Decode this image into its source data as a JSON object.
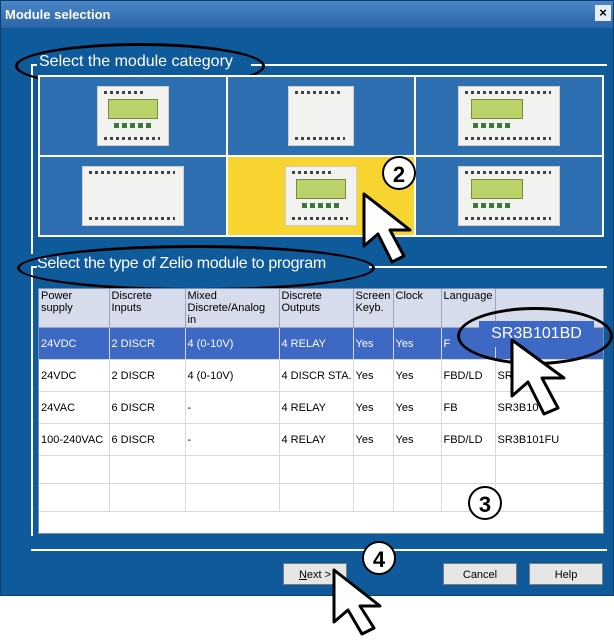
{
  "window": {
    "title": "Module selection",
    "close_label": "×"
  },
  "category_section": {
    "caption": "Select the module category"
  },
  "type_section": {
    "caption": "Select the type of Zelio module to program"
  },
  "table": {
    "headers": [
      "Power supply",
      "Discrete Inputs",
      "Mixed Discrete/Analog in",
      "Discrete Outputs",
      "Screen Keyb.",
      "Clock",
      "Language",
      ""
    ],
    "rows": [
      [
        "24VDC",
        "2 DISCR",
        "4 (0-10V)",
        "4 RELAY",
        "Yes",
        "Yes",
        "F",
        "SR3B101BD"
      ],
      [
        "24VDC",
        "2 DISCR",
        "4 (0-10V)",
        "4 DISCR STA.",
        "Yes",
        "Yes",
        "FBD/LD",
        "SR"
      ],
      [
        "24VAC",
        "6 DISCR",
        "-",
        "4 RELAY",
        "Yes",
        "Yes",
        "FB",
        "SR3B10"
      ],
      [
        "100-240VAC",
        "6 DISCR",
        "-",
        "4 RELAY",
        "Yes",
        "Yes",
        "FBD/LD",
        "SR3B101FU"
      ]
    ],
    "selected_reference": "SR3B101BD"
  },
  "buttons": {
    "next_prefix": "N",
    "next_rest": "ext >",
    "cancel": "Cancel",
    "help": "Help"
  },
  "callouts": {
    "step2": "2",
    "step3": "3",
    "step4": "4"
  },
  "colors": {
    "window_bg": "#0f5a9a",
    "tile_bg": "#2e6fb1",
    "tile_selected": "#f8d431",
    "row_selected": "#3d68c4"
  }
}
